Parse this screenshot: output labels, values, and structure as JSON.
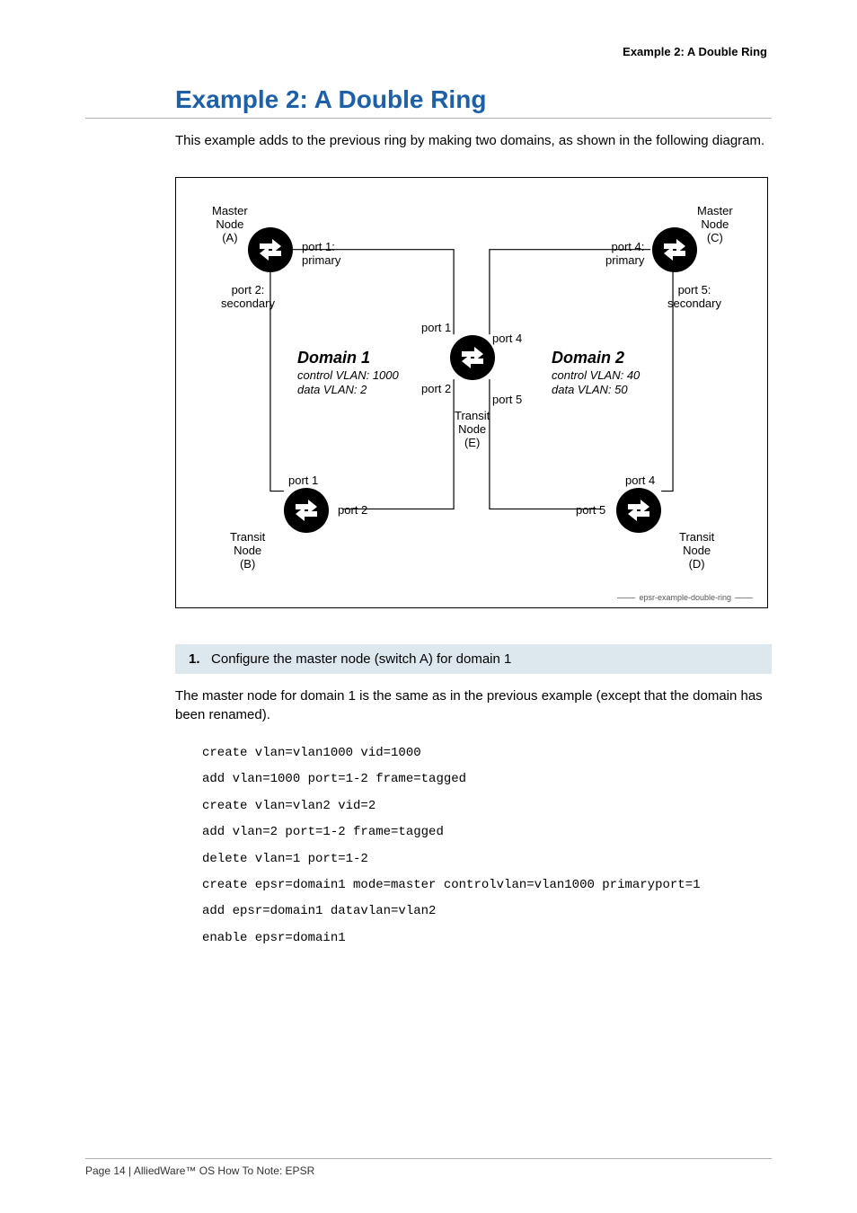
{
  "running_header": "Example 2: A Double Ring",
  "title": "Example 2: A Double Ring",
  "intro": "This example adds to the previous ring by making two domains, as shown in the following diagram.",
  "diagram": {
    "nodes": {
      "A": "Master\nNode\n(A)",
      "B": "Transit\nNode\n(B)",
      "C": "Master\nNode\n(C)",
      "D": "Transit\nNode\n(D)",
      "E": "Transit\nNode\n(E)"
    },
    "ports": {
      "a_p1": "port 1:\nprimary",
      "a_p2": "port 2:\nsecondary",
      "b_p1": "port 1",
      "b_p2": "port 2",
      "c_p4": "port 4:\nprimary",
      "c_p5": "port 5:\nsecondary",
      "d_p4": "port 4",
      "d_p5": "port 5",
      "e_p1": "port 1",
      "e_p2": "port 2",
      "e_p4": "port 4",
      "e_p5": "port 5"
    },
    "domain1": {
      "title": "Domain 1",
      "l1": "control VLAN: 1000",
      "l2": "data VLAN: 2"
    },
    "domain2": {
      "title": "Domain 2",
      "l1": "control VLAN: 40",
      "l2": "data VLAN: 50"
    },
    "caption": "epsr-example-double-ring"
  },
  "step": {
    "num": "1.",
    "title": "Configure the master node (switch A) for domain 1",
    "desc": "The master node for domain 1 is the same as in the previous example (except that the domain has been renamed).",
    "code": "create vlan=vlan1000 vid=1000\nadd vlan=1000 port=1-2 frame=tagged\ncreate vlan=vlan2 vid=2\nadd vlan=2 port=1-2 frame=tagged\ndelete vlan=1 port=1-2\ncreate epsr=domain1 mode=master controlvlan=vlan1000 primaryport=1\nadd epsr=domain1 datavlan=vlan2\nenable epsr=domain1"
  },
  "footer": "Page 14 | AlliedWare™ OS How To Note: EPSR"
}
